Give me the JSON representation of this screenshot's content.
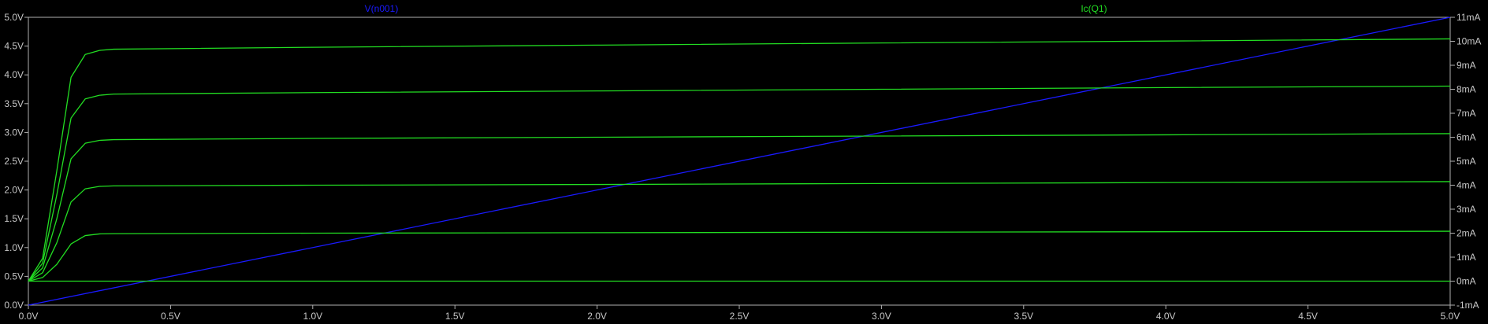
{
  "chart_data": {
    "type": "line",
    "background": "#000000",
    "axis_color": "#b0b0b0",
    "x_axis": {
      "min": 0,
      "max": 5.0,
      "tick_values": [
        0,
        0.5,
        1.0,
        1.5,
        2.0,
        2.5,
        3.0,
        3.5,
        4.0,
        4.5,
        5.0
      ],
      "tick_labels": [
        "0.0V",
        "0.5V",
        "1.0V",
        "1.5V",
        "2.0V",
        "2.5V",
        "3.0V",
        "3.5V",
        "4.0V",
        "4.5V",
        "5.0V"
      ]
    },
    "y_left": {
      "min": 0,
      "max": 5.0,
      "tick_values": [
        0,
        0.5,
        1.0,
        1.5,
        2.0,
        2.5,
        3.0,
        3.5,
        4.0,
        4.5,
        5.0
      ],
      "tick_labels": [
        "0.0V",
        "0.5V",
        "1.0V",
        "1.5V",
        "2.0V",
        "2.5V",
        "3.0V",
        "3.5V",
        "4.0V",
        "4.5V",
        "5.0V"
      ]
    },
    "y_right": {
      "min": -1,
      "max": 11,
      "tick_values": [
        -1,
        0,
        1,
        2,
        3,
        4,
        5,
        6,
        7,
        8,
        9,
        10,
        11
      ],
      "tick_labels": [
        "-1mA",
        "0mA",
        "1mA",
        "2mA",
        "3mA",
        "4mA",
        "5mA",
        "6mA",
        "7mA",
        "8mA",
        "9mA",
        "10mA",
        "11mA"
      ]
    },
    "series": [
      {
        "name": "V(n001)",
        "axis": "left",
        "color": "#1a1aff",
        "x": [
          0,
          5.0
        ],
        "y": [
          0,
          5.0
        ]
      },
      {
        "name": "Ic(Q1)",
        "axis": "right",
        "color": "#22dd22",
        "curves": [
          {
            "x": [
              0,
              0.05,
              0.1,
              0.15,
              0.2,
              0.25,
              0.3,
              1.0,
              2.0,
              3.0,
              4.0,
              5.0
            ],
            "y": [
              0,
              0,
              0,
              0,
              0,
              0,
              0,
              0,
              0,
              0,
              0,
              0
            ]
          },
          {
            "x": [
              0,
              0.05,
              0.1,
              0.15,
              0.2,
              0.25,
              0.3,
              1.0,
              2.0,
              3.0,
              4.0,
              5.0
            ],
            "y": [
              0,
              0.15,
              0.7,
              1.55,
              1.9,
              1.97,
              1.98,
              2.0,
              2.02,
              2.04,
              2.06,
              2.08
            ]
          },
          {
            "x": [
              0,
              0.05,
              0.1,
              0.15,
              0.2,
              0.25,
              0.3,
              1.0,
              2.0,
              3.0,
              4.0,
              5.0
            ],
            "y": [
              0,
              0.35,
              1.6,
              3.3,
              3.85,
              3.95,
              3.97,
              4.0,
              4.03,
              4.07,
              4.11,
              4.15
            ]
          },
          {
            "x": [
              0,
              0.05,
              0.1,
              0.15,
              0.2,
              0.25,
              0.3,
              1.0,
              2.0,
              3.0,
              4.0,
              5.0
            ],
            "y": [
              0,
              0.55,
              2.6,
              5.1,
              5.75,
              5.87,
              5.9,
              5.95,
              6.0,
              6.05,
              6.1,
              6.15
            ]
          },
          {
            "x": [
              0,
              0.05,
              0.1,
              0.15,
              0.2,
              0.25,
              0.3,
              1.0,
              2.0,
              3.0,
              4.0,
              5.0
            ],
            "y": [
              0,
              0.75,
              3.6,
              6.8,
              7.6,
              7.75,
              7.8,
              7.86,
              7.93,
              8.0,
              8.07,
              8.13
            ]
          },
          {
            "x": [
              0,
              0.05,
              0.1,
              0.15,
              0.2,
              0.25,
              0.3,
              1.0,
              2.0,
              3.0,
              4.0,
              5.0
            ],
            "y": [
              0,
              0.95,
              4.6,
              8.5,
              9.45,
              9.62,
              9.67,
              9.75,
              9.84,
              9.93,
              10.01,
              10.1
            ]
          }
        ]
      }
    ]
  }
}
